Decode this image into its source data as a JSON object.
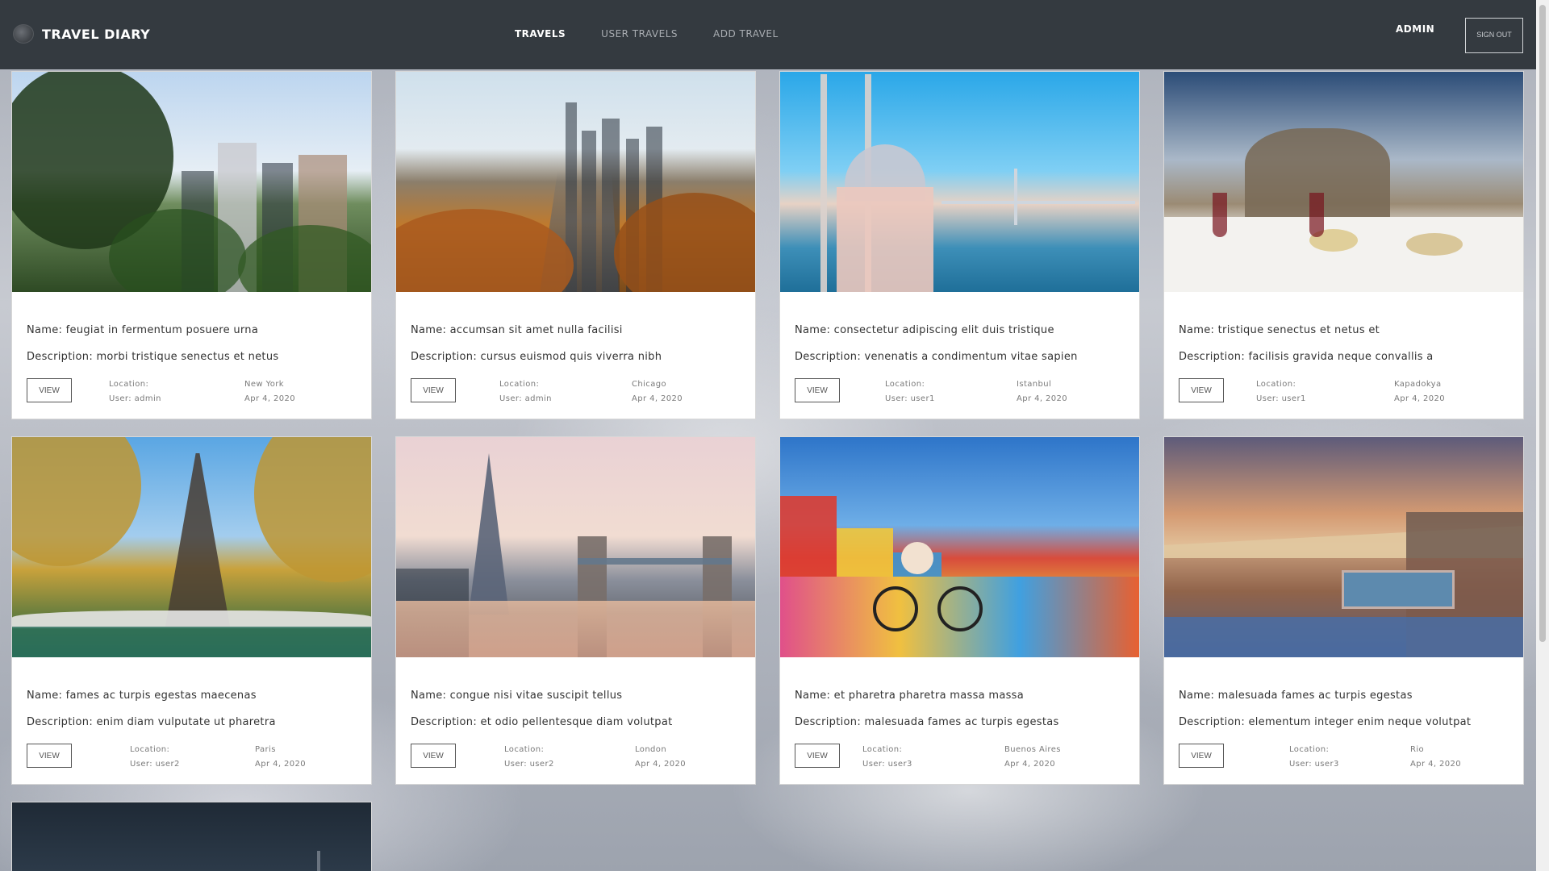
{
  "brand": {
    "name": "TRAVEL DIARY",
    "logo_icon": "globe-icon"
  },
  "nav": {
    "links": [
      {
        "label": "TRAVELS",
        "active": true
      },
      {
        "label": "USER TRAVELS",
        "active": false
      },
      {
        "label": "ADD TRAVEL",
        "active": false
      }
    ],
    "user": "ADMIN",
    "signout": "SIGN OUT"
  },
  "cards": [
    {
      "name": "Name: feugiat in fermentum posuere urna",
      "description": "Description: morbi tristique senectus et netus",
      "view": "VIEW",
      "location_label": "Location:",
      "location": "New York",
      "user": "User: admin",
      "date": "Apr 4, 2020",
      "image": "new-york-park-skyline"
    },
    {
      "name": "Name: accumsan sit amet nulla facilisi",
      "description": "Description: cursus euismod quis viverra nibh",
      "view": "VIEW",
      "location_label": "Location:",
      "location": "Chicago",
      "user": "User: admin",
      "date": "Apr 4, 2020",
      "image": "chicago-autumn-river"
    },
    {
      "name": "Name: consectetur adipiscing elit duis tristique",
      "description": "Description: venenatis a condimentum vitae sapien",
      "view": "VIEW",
      "location_label": "Location:",
      "location": "Istanbul",
      "user": "User: user1",
      "date": "Apr 4, 2020",
      "image": "istanbul-mosque-bridge"
    },
    {
      "name": "Name: tristique senectus et netus et",
      "description": "Description: facilisis gravida neque convallis a",
      "view": "VIEW",
      "location_label": "Location:",
      "location": "Kapadokya",
      "user": "User: user1",
      "date": "Apr 4, 2020",
      "image": "cappadocia-dinner-table"
    },
    {
      "name": "Name: fames ac turpis egestas maecenas",
      "description": "Description: enim diam vulputate ut pharetra",
      "view": "VIEW",
      "location_label": "Location:",
      "location": "Paris",
      "user": "User: user2",
      "date": "Apr 4, 2020",
      "image": "paris-eiffel-tower"
    },
    {
      "name": "Name: congue nisi vitae suscipit tellus",
      "description": "Description: et odio pellentesque diam volutpat",
      "view": "VIEW",
      "location_label": "Location:",
      "location": "London",
      "user": "User: user2",
      "date": "Apr 4, 2020",
      "image": "london-tower-bridge"
    },
    {
      "name": "Name: et pharetra pharetra massa massa",
      "description": "Description: malesuada fames ac turpis egestas",
      "view": "VIEW",
      "location_label": "Location:",
      "location": "Buenos Aires",
      "user": "User: user3",
      "date": "Apr 4, 2020",
      "image": "buenos-aires-cyclist"
    },
    {
      "name": "Name: malesuada fames ac turpis egestas",
      "description": "Description: elementum integer enim neque volutpat",
      "view": "VIEW",
      "location_label": "Location:",
      "location": "Rio",
      "user": "User: user3",
      "date": "Apr 4, 2020",
      "image": "rio-beach-pool"
    }
  ]
}
